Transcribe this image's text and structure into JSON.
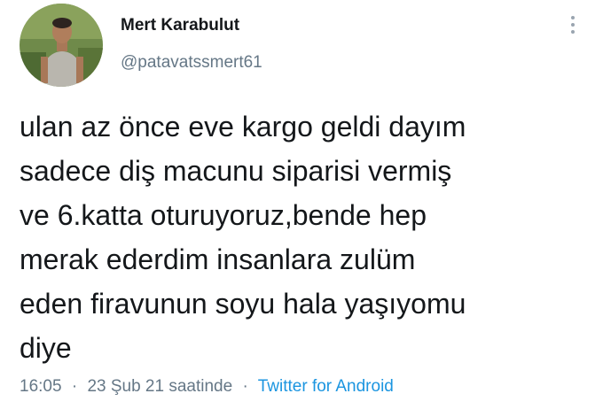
{
  "user": {
    "display_name": "Mert Karabulut",
    "handle": "@patavatssmert61",
    "avatar_icon": "profile-photo"
  },
  "tweet": {
    "lines": [
      "ulan az önce eve kargo geldi dayım",
      "sadece diş macunu siparisi vermiş",
      "ve 6.katta oturuyoruz,bende hep",
      "merak ederdim insanlara zulüm",
      "eden firavunun soyu hala yaşıyomu",
      "diye"
    ]
  },
  "meta": {
    "time": "16:05",
    "separator": "·",
    "date": "23 Şub 21 saatinde",
    "source": "Twitter for Android"
  },
  "colors": {
    "text": "#14171a",
    "secondary": "#657786",
    "link": "#1b95e0"
  },
  "more_icon": "more-vertical-icon"
}
